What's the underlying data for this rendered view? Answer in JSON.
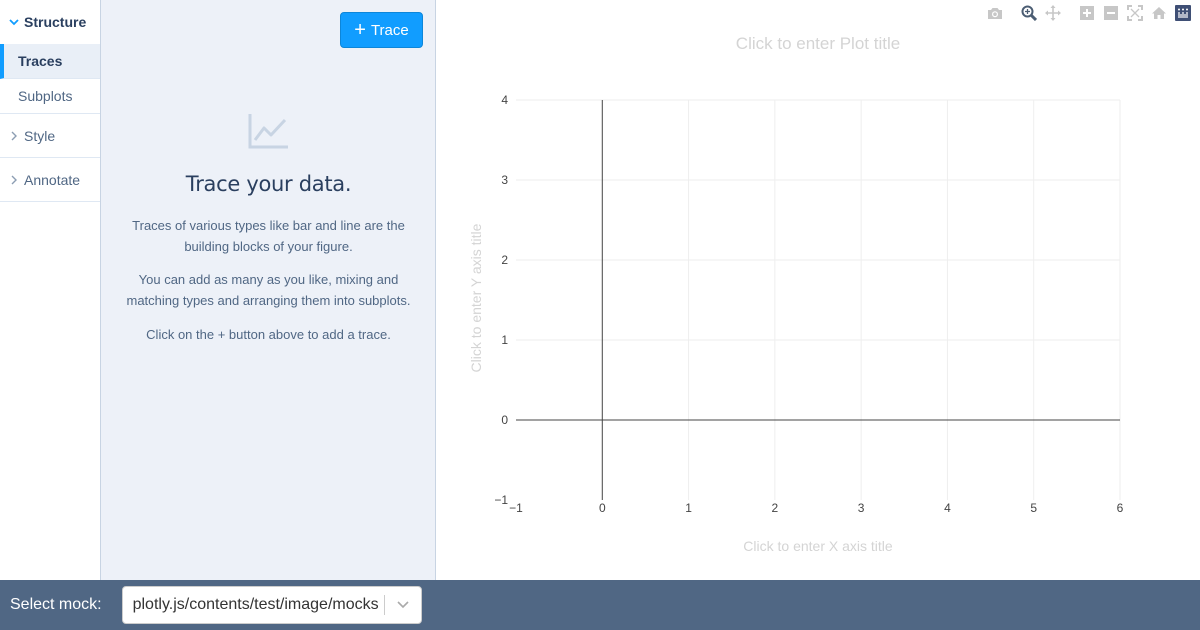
{
  "nav": {
    "structure_label": "Structure",
    "traces_label": "Traces",
    "subplots_label": "Subplots",
    "style_label": "Style",
    "annotate_label": "Annotate"
  },
  "panel": {
    "add_button_label": "Trace",
    "add_button_icon": "+",
    "empty_title": "Trace your data.",
    "empty_p1": "Traces of various types like bar and line are the building blocks of your figure.",
    "empty_p2": "You can add as many as you like, mixing and matching types and arranging them into subplots.",
    "empty_p3": "Click on the + button above to add a trace."
  },
  "plot": {
    "title_placeholder": "Click to enter Plot title",
    "xaxis_placeholder": "Click to enter X axis title",
    "yaxis_placeholder": "Click to enter Y axis title",
    "modebar": [
      "camera-icon",
      "zoom-icon",
      "pan-icon",
      "zoom-in-icon",
      "zoom-out-icon",
      "autoscale-icon",
      "home-icon",
      "plotly-logo-icon"
    ]
  },
  "chart_data": {
    "type": "scatter",
    "series": [],
    "xlim": [
      -1,
      6
    ],
    "ylim": [
      -1,
      4
    ],
    "xticks": [
      "−1",
      "0",
      "1",
      "2",
      "3",
      "4",
      "5",
      "6"
    ],
    "yticks": [
      "−1",
      "0",
      "1",
      "2",
      "3",
      "4"
    ],
    "grid": true,
    "zeroline_color": "#444444",
    "grid_color": "#eeeeee"
  },
  "footer": {
    "label": "Select mock:",
    "selected_value": "plotly.js/contents/test/image/mocks"
  },
  "colors": {
    "accent": "#119dff",
    "footer_bg": "#506784",
    "panel_bg": "#edf1f8"
  }
}
